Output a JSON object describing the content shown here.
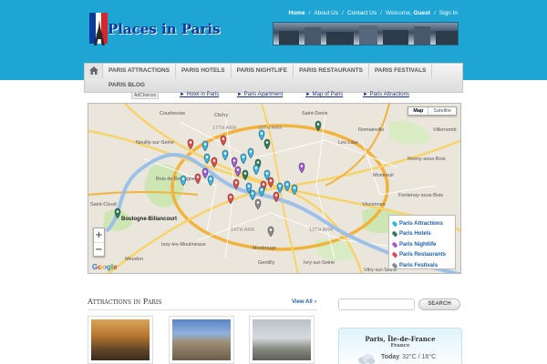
{
  "brand": {
    "logo_text": "Places in Paris",
    "accent": "#1fa5d4",
    "title_color": "#0a3a9c"
  },
  "top_nav": {
    "home": "Home",
    "about": "About Us",
    "contact": "Contact Us",
    "welcome_prefix": "Welcome,",
    "guest": "Guest",
    "sign_in": "Sign In",
    "separator": "/"
  },
  "main_nav": {
    "home_icon": "home-icon",
    "items": [
      {
        "label": "Paris Attractions"
      },
      {
        "label": "Paris Hotels"
      },
      {
        "label": "Paris Nightlife"
      },
      {
        "label": "Paris Restaurants"
      },
      {
        "label": "Paris Festivals"
      }
    ],
    "second_row": [
      {
        "label": "Paris Blog"
      }
    ]
  },
  "sub_links": {
    "adchoices": "AdChoices",
    "items": [
      {
        "label": "► Hotel in Paris"
      },
      {
        "label": "► Paris Apartment"
      },
      {
        "label": "► Map of Paris"
      },
      {
        "label": "► Paris Attractions"
      }
    ]
  },
  "map": {
    "map_type": {
      "active": "Map",
      "inactive": "Satellite"
    },
    "zoom_in": "+",
    "zoom_out": "−",
    "google": "Google",
    "places": [
      {
        "label": "Courbevoie"
      },
      {
        "label": "Clichy"
      },
      {
        "label": "17TH ARR"
      },
      {
        "label": "18TH ARR"
      },
      {
        "label": "Neuilly-sur-Seine"
      },
      {
        "label": "Saint-Denis"
      },
      {
        "label": "Romainville"
      },
      {
        "label": "Villemomb"
      },
      {
        "label": "Les Lilas"
      },
      {
        "label": "Rosny-sous-Bois"
      },
      {
        "label": "Montreuil"
      },
      {
        "label": "Bois de Boulogne"
      },
      {
        "label": "Fontenay-sous-Bois"
      },
      {
        "label": "Saint-Cloud"
      },
      {
        "label": "Boulogne-Billancourt"
      },
      {
        "label": "Vincennes"
      },
      {
        "label": "Issy-les-Moulineaux"
      },
      {
        "label": "14TH ARR"
      },
      {
        "label": "13TH ARR"
      },
      {
        "label": "Montrouge"
      },
      {
        "label": "Ivry-sur-Seine"
      },
      {
        "label": "Gentilly"
      },
      {
        "label": "Meudon"
      },
      {
        "label": "Vitry-sur-Seine"
      }
    ],
    "legend": [
      {
        "label": "Paris Attractions",
        "color": "#35b6e6"
      },
      {
        "label": "Paris Hotels",
        "color": "#2e7b5a"
      },
      {
        "label": "Paris Nightlife",
        "color": "#a05ad6"
      },
      {
        "label": "Paris Restaurants",
        "color": "#e04b4b"
      },
      {
        "label": "Paris Festivals",
        "color": "#8a8a8a"
      }
    ]
  },
  "attractions": {
    "title": "Attractions in Paris",
    "view_all": "View All"
  },
  "sidebar": {
    "search_button": "SEARCH",
    "weather": {
      "city": "Paris, Île-de-France",
      "country": "France",
      "today_label": "Today",
      "temps": "32°C / 16°C"
    }
  }
}
